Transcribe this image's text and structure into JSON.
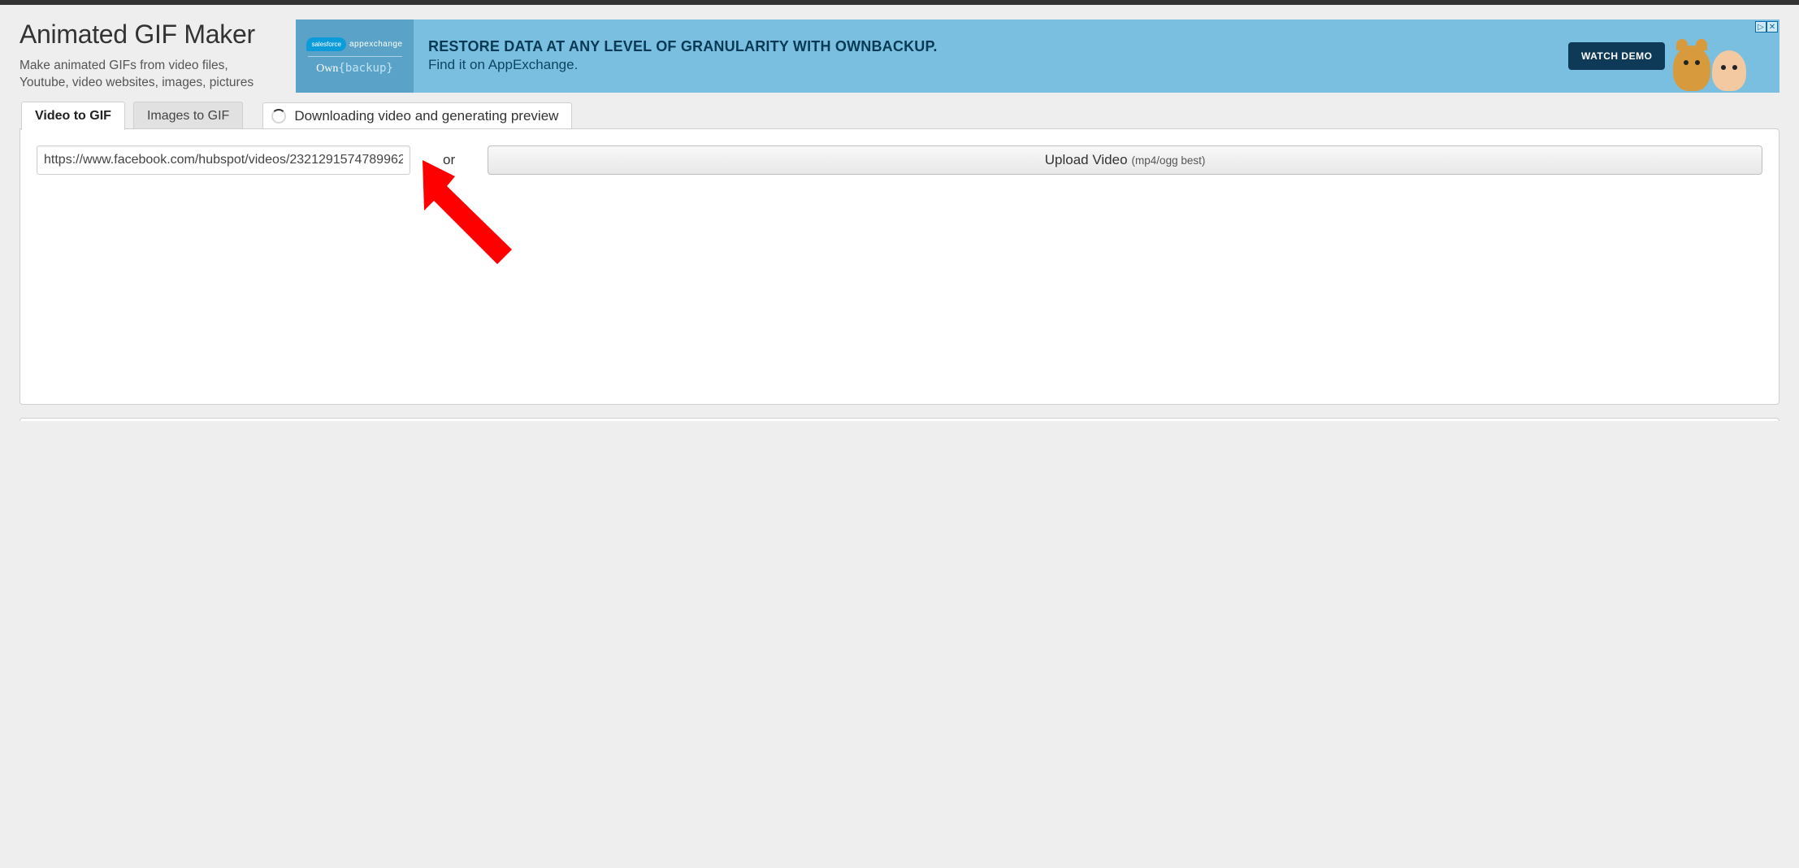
{
  "header": {
    "title": "Animated GIF Maker",
    "subtitle": "Make animated GIFs from video files, Youtube, video websites, images, pictures"
  },
  "ad": {
    "brand_cloud": "salesforce",
    "brand_appex": "appexchange",
    "brand_own_prefix": "Own",
    "brand_own_brace": "{backup}",
    "headline": "RESTORE DATA AT ANY LEVEL OF GRANULARITY WITH OWNBACKUP.",
    "subline": "Find it on AppExchange.",
    "cta": "WATCH DEMO",
    "corner_play": "▷",
    "corner_close": "✕"
  },
  "tabs": {
    "video_to_gif": "Video to GIF",
    "images_to_gif": "Images to GIF"
  },
  "status": {
    "text": "Downloading video and generating preview"
  },
  "form": {
    "url_value": "https://www.facebook.com/hubspot/videos/2321291574789962",
    "or": "or",
    "upload_label": "Upload Video",
    "upload_hint": "(mp4/ogg best)"
  }
}
